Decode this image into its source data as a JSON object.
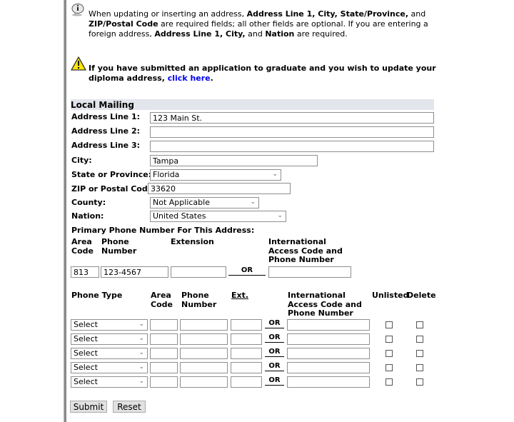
{
  "notices": {
    "info": {
      "icon": "info-bubble-icon",
      "segments": [
        {
          "text": "When updating or inserting an address, ",
          "bold": false
        },
        {
          "text": "Address Line 1, City, State/Province,",
          "bold": true
        },
        {
          "text": " and ",
          "bold": false
        },
        {
          "text": "ZIP/Postal Code",
          "bold": true
        },
        {
          "text": " are required fields; all other fields are optional. If you are entering a foreign address, ",
          "bold": false
        },
        {
          "text": "Address Line 1, City,",
          "bold": true
        },
        {
          "text": " and ",
          "bold": false
        },
        {
          "text": "Nation",
          "bold": true
        },
        {
          "text": " are required.",
          "bold": false
        }
      ]
    },
    "warning": {
      "icon": "warning-triangle-icon",
      "text": "If you have submitted an application to graduate and you wish to update your diploma address, ",
      "link_text": "click here",
      "after_link": "."
    }
  },
  "section": {
    "title": "Local Mailing"
  },
  "address": {
    "line1_label": "Address Line 1:",
    "line1_value": "123 Main St.",
    "line2_label": "Address Line 2:",
    "line2_value": "",
    "line3_label": "Address Line 3:",
    "line3_value": "",
    "city_label": "City:",
    "city_value": "Tampa",
    "state_label": "State or Province:",
    "state_value": "Florida",
    "zip_label": "ZIP or Postal Code:",
    "zip_value": "33620",
    "county_label": "County:",
    "county_value": "Not Applicable",
    "nation_label": "Nation:",
    "nation_value": "United States"
  },
  "primary_phone": {
    "title": "Primary Phone Number For This Address:",
    "area_code_header": "Area Code",
    "phone_number_header": "Phone Number",
    "extension_header": "Extension",
    "intl_header": "International Access Code and Phone Number",
    "area_code_value": "813",
    "phone_number_value": "123-4567",
    "extension_value": "",
    "intl_value": "",
    "or_label": "OR"
  },
  "phones": {
    "headers": {
      "phone_type": "Phone Type",
      "area_code": "Area Code",
      "phone_number": "Phone Number",
      "ext": "Ext.",
      "intl": "International Access Code and Phone Number",
      "unlisted": "Unlisted",
      "delete": "Delete"
    },
    "or_label": "OR",
    "rows": [
      {
        "type": "Select",
        "area": "",
        "number": "",
        "ext": "",
        "intl": "",
        "unlisted": false,
        "delete": false
      },
      {
        "type": "Select",
        "area": "",
        "number": "",
        "ext": "",
        "intl": "",
        "unlisted": false,
        "delete": false
      },
      {
        "type": "Select",
        "area": "",
        "number": "",
        "ext": "",
        "intl": "",
        "unlisted": false,
        "delete": false
      },
      {
        "type": "Select",
        "area": "",
        "number": "",
        "ext": "",
        "intl": "",
        "unlisted": false,
        "delete": false
      },
      {
        "type": "Select",
        "area": "",
        "number": "",
        "ext": "",
        "intl": "",
        "unlisted": false,
        "delete": false
      }
    ]
  },
  "buttons": {
    "submit": "Submit",
    "reset": "Reset"
  }
}
